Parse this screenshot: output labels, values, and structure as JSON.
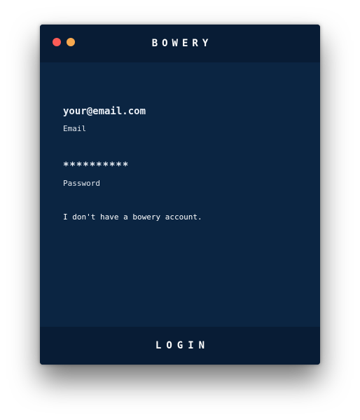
{
  "window": {
    "title": "BOWERY",
    "controls": [
      {
        "name": "close",
        "color": "#fc5c57"
      },
      {
        "name": "minimize",
        "color": "#f7a94f"
      }
    ]
  },
  "form": {
    "email": {
      "value": "your@email.com",
      "label": "Email"
    },
    "password": {
      "value": "**********",
      "label": "Password"
    },
    "no_account_link": "I don't have a bowery account."
  },
  "footer": {
    "login_label": "LOGIN"
  },
  "colors": {
    "background": "#0b2542",
    "bar": "#081c35",
    "text": "#ffffff"
  }
}
